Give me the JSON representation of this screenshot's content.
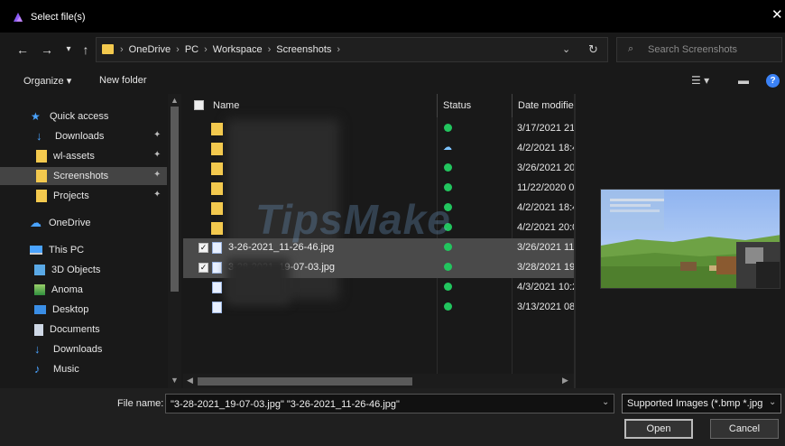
{
  "window": {
    "title": "Select file(s)",
    "close_glyph": "✕"
  },
  "nav": {
    "back": "←",
    "forward": "→",
    "recent": "▾",
    "up": "↑"
  },
  "address": {
    "crumbs": [
      "OneDrive",
      "PC",
      "Workspace",
      "Screenshots"
    ],
    "separator": "›",
    "dropdown": "⌄",
    "refresh": "↻"
  },
  "search": {
    "placeholder": "Search Screenshots",
    "icon": "⌕"
  },
  "toolbar": {
    "organize": "Organize ▾",
    "new_folder": "New folder",
    "view_icon": "☰ ▾",
    "pane_icon": "▬",
    "help": "?"
  },
  "sidebar": {
    "items": [
      {
        "label": "Quick access",
        "icon": "star-icon",
        "pinned": false
      },
      {
        "label": "Downloads",
        "icon": "download-icon",
        "pinned": true
      },
      {
        "label": "wl-assets",
        "icon": "folder-icon",
        "pinned": true
      },
      {
        "label": "Screenshots",
        "icon": "folder-icon",
        "pinned": true,
        "selected": true
      },
      {
        "label": "Projects",
        "icon": "folder-icon",
        "pinned": true
      },
      {
        "label": "OneDrive",
        "icon": "cloud-icon",
        "pinned": false
      },
      {
        "label": "This PC",
        "icon": "computer-icon",
        "pinned": false
      },
      {
        "label": "3D Objects",
        "icon": "cube-icon",
        "pinned": false
      },
      {
        "label": "Anoma",
        "icon": "image-icon",
        "pinned": false
      },
      {
        "label": "Desktop",
        "icon": "desktop-icon",
        "pinned": false
      },
      {
        "label": "Documents",
        "icon": "document-icon",
        "pinned": false
      },
      {
        "label": "Downloads",
        "icon": "download-icon",
        "pinned": false
      },
      {
        "label": "Music",
        "icon": "music-icon",
        "pinned": false
      }
    ],
    "pin_glyph": "📌"
  },
  "columns": {
    "name": "Name",
    "status": "Status",
    "date": "Date modifie"
  },
  "files": [
    {
      "type": "folder",
      "name": "",
      "status": "ok",
      "date": "3/17/2021 21:"
    },
    {
      "type": "folder",
      "name": "",
      "status": "cloud",
      "date": "4/2/2021 18:4"
    },
    {
      "type": "folder",
      "name": "",
      "status": "ok",
      "date": "3/26/2021 20:"
    },
    {
      "type": "folder",
      "name": "",
      "status": "ok",
      "date": "11/22/2020 0("
    },
    {
      "type": "folder",
      "name": "",
      "status": "ok",
      "date": "4/2/2021 18:4"
    },
    {
      "type": "folder",
      "name": "",
      "status": "ok",
      "date": "4/2/2021 20:0"
    },
    {
      "type": "image",
      "name": "3-26-2021_11-26-46.jpg",
      "status": "ok",
      "date": "3/26/2021 11:",
      "selected": true
    },
    {
      "type": "image",
      "name": "3-28-2021_19-07-03.jpg",
      "status": "ok",
      "date": "3/28/2021 19:",
      "selected": true
    },
    {
      "type": "image",
      "name": "",
      "status": "ok",
      "date": "4/3/2021 10:2"
    },
    {
      "type": "image",
      "name": "",
      "status": "ok",
      "date": "3/13/2021 08:"
    }
  ],
  "watermark": "TipsMake",
  "footer": {
    "file_name_label": "File name:",
    "file_name_value": "\"3-28-2021_19-07-03.jpg\" \"3-26-2021_11-26-46.jpg\"",
    "file_type": "Supported Images (*.bmp *.jpg",
    "open_label": "Open",
    "cancel_label": "Cancel"
  },
  "colors": {
    "folder": "#f3c94e",
    "status_ok": "#22c55e",
    "cloud": "#7dc4ff",
    "help": "#3b82f6"
  }
}
